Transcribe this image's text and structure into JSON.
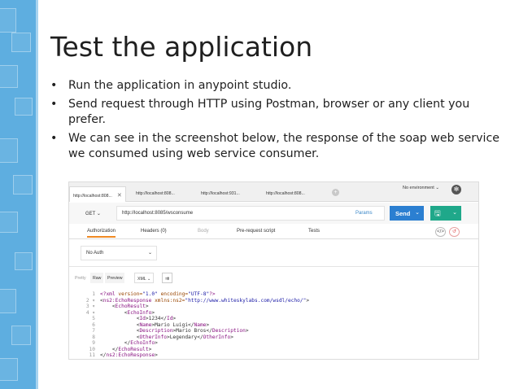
{
  "slide": {
    "title": "Test the application",
    "bullet_symbol": "•",
    "bullets": [
      "Run the application in anypoint studio.",
      "Send request through HTTP using Postman, browser or any client you prefer.",
      "We can see in the screenshot below, the response of the soap web service we consumed using web service consumer."
    ]
  },
  "postman": {
    "tabs": [
      {
        "label": "http://localhost:808...",
        "active": true
      },
      {
        "label": "http://localhost:808...",
        "active": false
      },
      {
        "label": "http://localhost:931...",
        "active": false
      },
      {
        "label": "http://localhost:808...",
        "active": false
      }
    ],
    "tab_close": "✕",
    "add_tab": "+",
    "environment": "No environment",
    "dropdown_chevron": "⌄",
    "gear_glyph": "✻",
    "method": "GET",
    "url": "http://localhost:8085/wsconsume",
    "params_label": "Params",
    "send_label": "Send",
    "save_glyph": "🖫",
    "request_tabs": [
      {
        "label": "Authorization",
        "state": "active"
      },
      {
        "label": "Headers (0)",
        "state": "normal"
      },
      {
        "label": "Body",
        "state": "muted"
      },
      {
        "label": "Pre-request script",
        "state": "normal"
      },
      {
        "label": "Tests",
        "state": "normal"
      }
    ],
    "code_icon": "</>",
    "reset_icon": "↺",
    "auth_type": "No Auth",
    "response_tools": {
      "pretty": "Pretty",
      "raw": "Raw",
      "preview": "Preview",
      "format": "XML",
      "wrap_glyph": "⇉"
    },
    "code_lines": [
      {
        "num": "1",
        "html": "<span class=\"t-tag\">&lt;?xml</span> <span class=\"t-attr\">version=</span><span class=\"t-val\">\"1.0\"</span> <span class=\"t-attr\">encoding=</span><span class=\"t-val\">\"UTF-8\"</span><span class=\"t-tag\">?&gt;</span>"
      },
      {
        "num": "2 ▾",
        "html": "&lt;<span class=\"t-tag\">ns2:EchoResponse</span> <span class=\"t-attr\">xmlns:ns2=</span><span class=\"t-val\">\"http://www.whiteskylabs.com/wsdl/echo/\"</span>&gt;"
      },
      {
        "num": "3 ▾",
        "html": "    &lt;<span class=\"t-tag\">EchoResult</span>&gt;"
      },
      {
        "num": "4 ▾",
        "html": "        &lt;<span class=\"t-tag\">EchoInfo</span>&gt;"
      },
      {
        "num": "5",
        "html": "            &lt;<span class=\"t-tag\">Id</span>&gt;1234&lt;/<span class=\"t-tag\">Id</span>&gt;"
      },
      {
        "num": "6",
        "html": "            &lt;<span class=\"t-tag\">Name</span>&gt;Mario Luigi&lt;/<span class=\"t-tag\">Name</span>&gt;"
      },
      {
        "num": "7",
        "html": "            &lt;<span class=\"t-tag\">Description</span>&gt;Mario Bros&lt;/<span class=\"t-tag\">Description</span>&gt;"
      },
      {
        "num": "8",
        "html": "            &lt;<span class=\"t-tag\">OtherInfo</span>&gt;Legendary&lt;/<span class=\"t-tag\">OtherInfo</span>&gt;"
      },
      {
        "num": "9",
        "html": "        &lt;/<span class=\"t-tag\">EchoInfo</span>&gt;"
      },
      {
        "num": "10",
        "html": "    &lt;/<span class=\"t-tag\">EchoResult</span>&gt;"
      },
      {
        "num": "11",
        "html": "&lt;/<span class=\"t-tag\">ns2:EchoResponse</span>&gt;"
      }
    ]
  },
  "colors": {
    "band": "#5eaee0",
    "send": "#2b7fd1",
    "save": "#1fa88a",
    "active_tab_underline": "#f08a24"
  }
}
